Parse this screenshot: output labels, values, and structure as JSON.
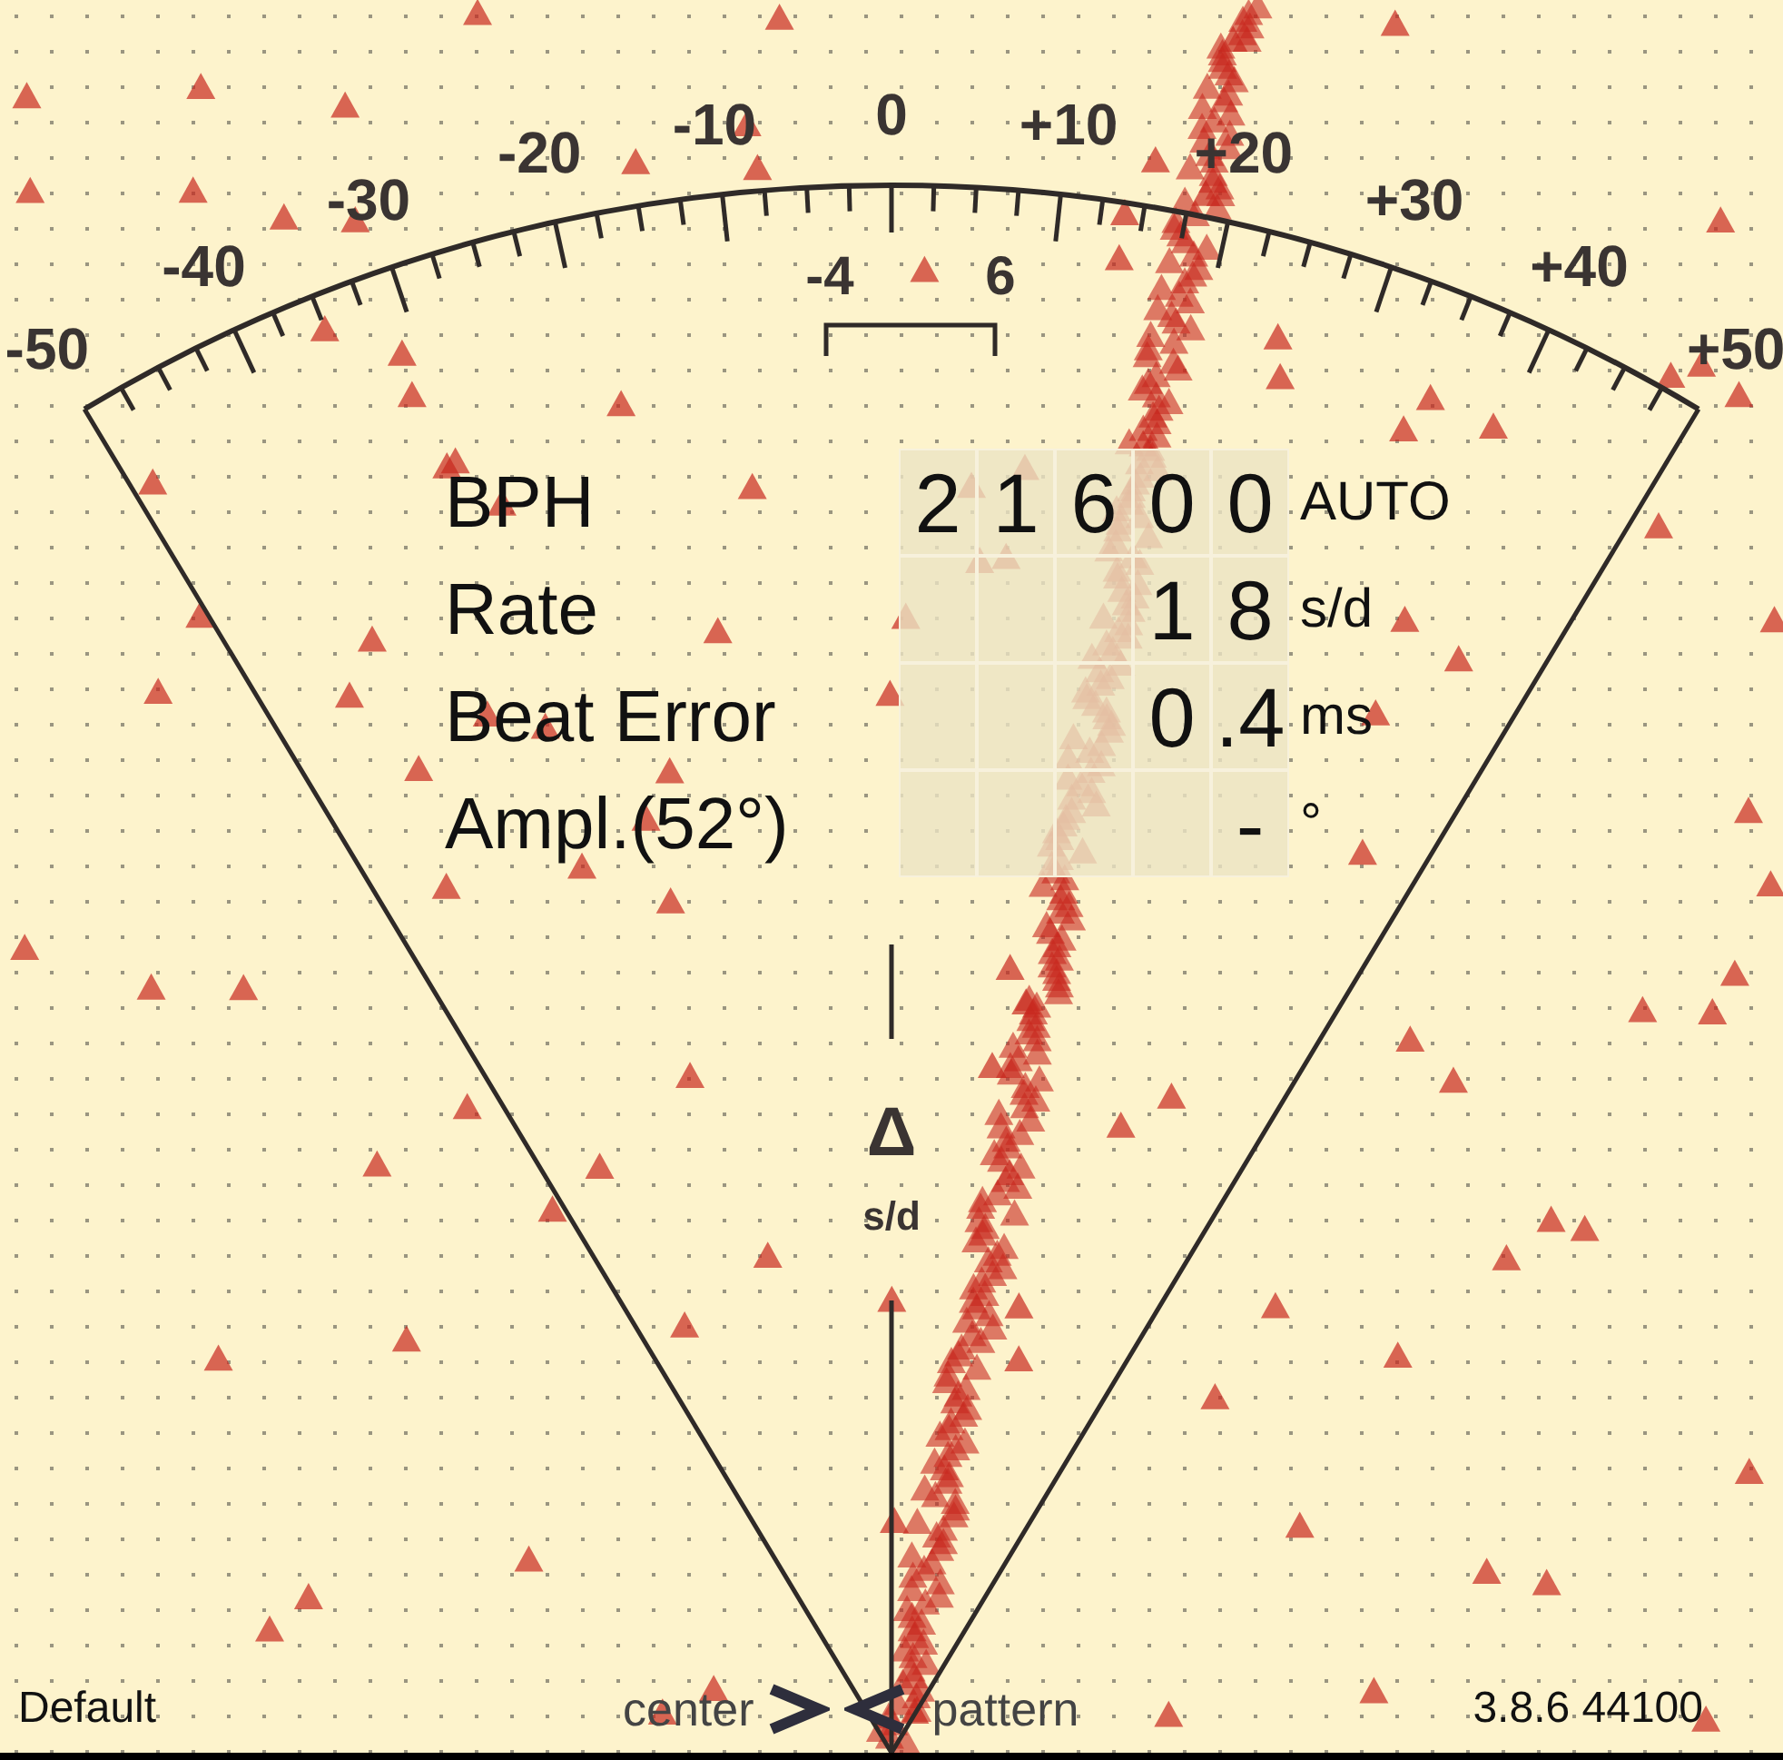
{
  "dial": {
    "scale_labels": [
      "-50",
      "-40",
      "-30",
      "-20",
      "-10",
      "0",
      "+10",
      "+20",
      "+30",
      "+40",
      "+50"
    ],
    "inner_labels": [
      "-4",
      "6"
    ],
    "delta_symbol": "Δ",
    "delta_unit": "s/d"
  },
  "readouts": [
    {
      "label": "BPH",
      "digits": [
        "2",
        "1",
        "6",
        "0",
        "0"
      ],
      "unit": "AUTO"
    },
    {
      "label": "Rate",
      "digits": [
        "1",
        "8"
      ],
      "unit": "s/d"
    },
    {
      "label": "Beat Error",
      "digits": [
        "0",
        ".4"
      ],
      "unit": "ms"
    },
    {
      "label": "Ampl.(52°)",
      "digits": [
        "-"
      ],
      "unit": "°"
    }
  ],
  "footer": {
    "profile": "Default",
    "left_button": "center",
    "right_button": "pattern",
    "version": "3.8.6 44100"
  }
}
